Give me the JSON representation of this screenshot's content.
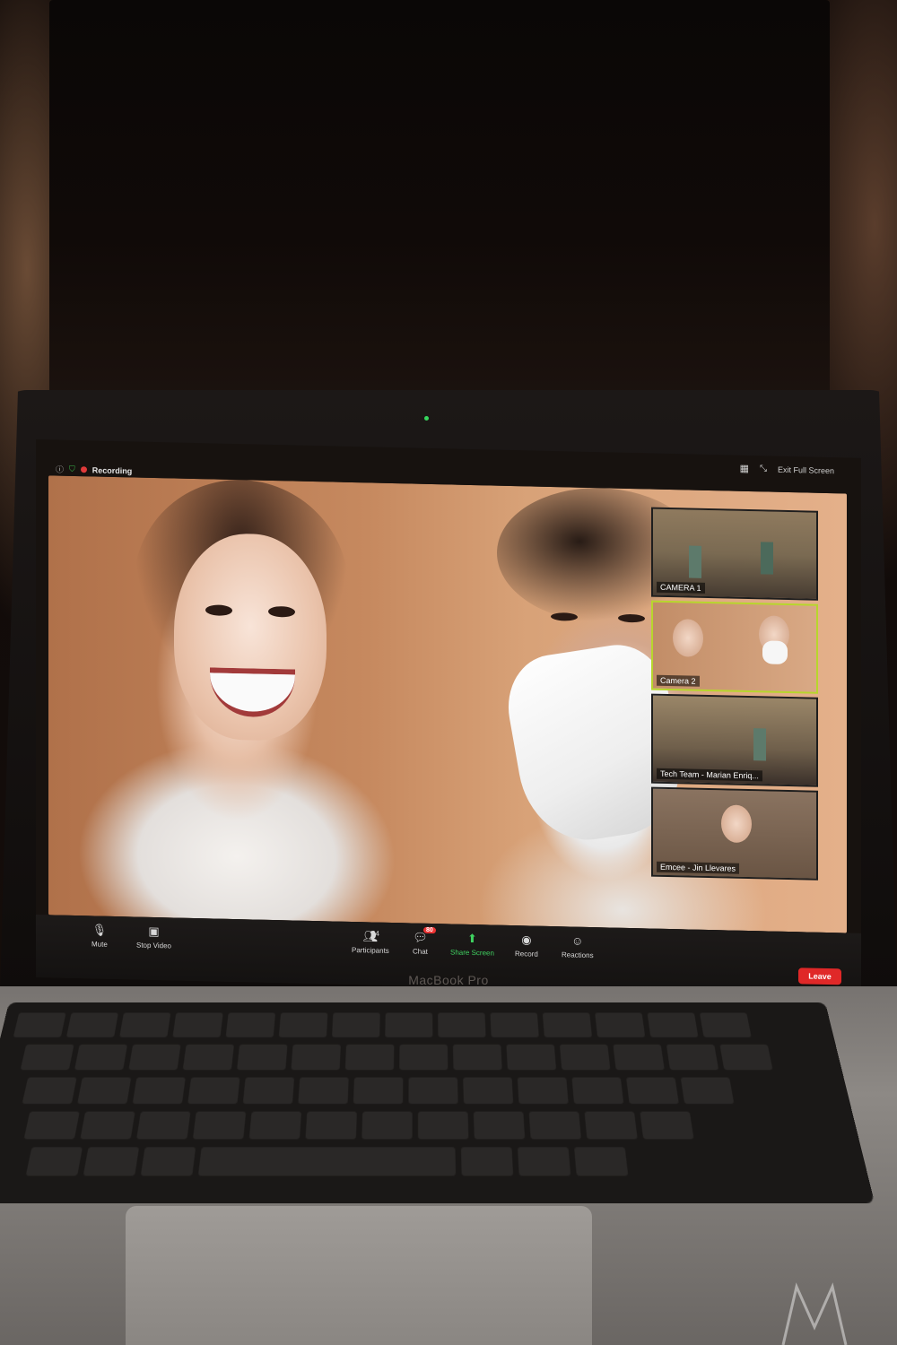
{
  "meeting": {
    "recording_label": "Recording",
    "exit_fullscreen_label": "Exit Full Screen"
  },
  "participants_strip": [
    {
      "name": "CAMERA 1",
      "active": false
    },
    {
      "name": "Camera 2",
      "active": true
    },
    {
      "name": "Tech Team - Marian Enriq...",
      "active": false
    },
    {
      "name": "Emcee - Jin Llevares",
      "active": false
    }
  ],
  "toolbar": {
    "mute_label": "Mute",
    "stop_video_label": "Stop Video",
    "participants_label": "Participants",
    "participants_count": "64",
    "chat_label": "Chat",
    "chat_badge": "80",
    "share_screen_label": "Share Screen",
    "record_label": "Record",
    "reactions_label": "Reactions",
    "leave_label": "Leave"
  },
  "device": {
    "bezel_label": "MacBook Pro"
  },
  "colors": {
    "share_green": "#3fd160",
    "leave_red": "#e02828",
    "recording_red": "#e03a3a",
    "active_tile_border": "#b7d62c"
  }
}
